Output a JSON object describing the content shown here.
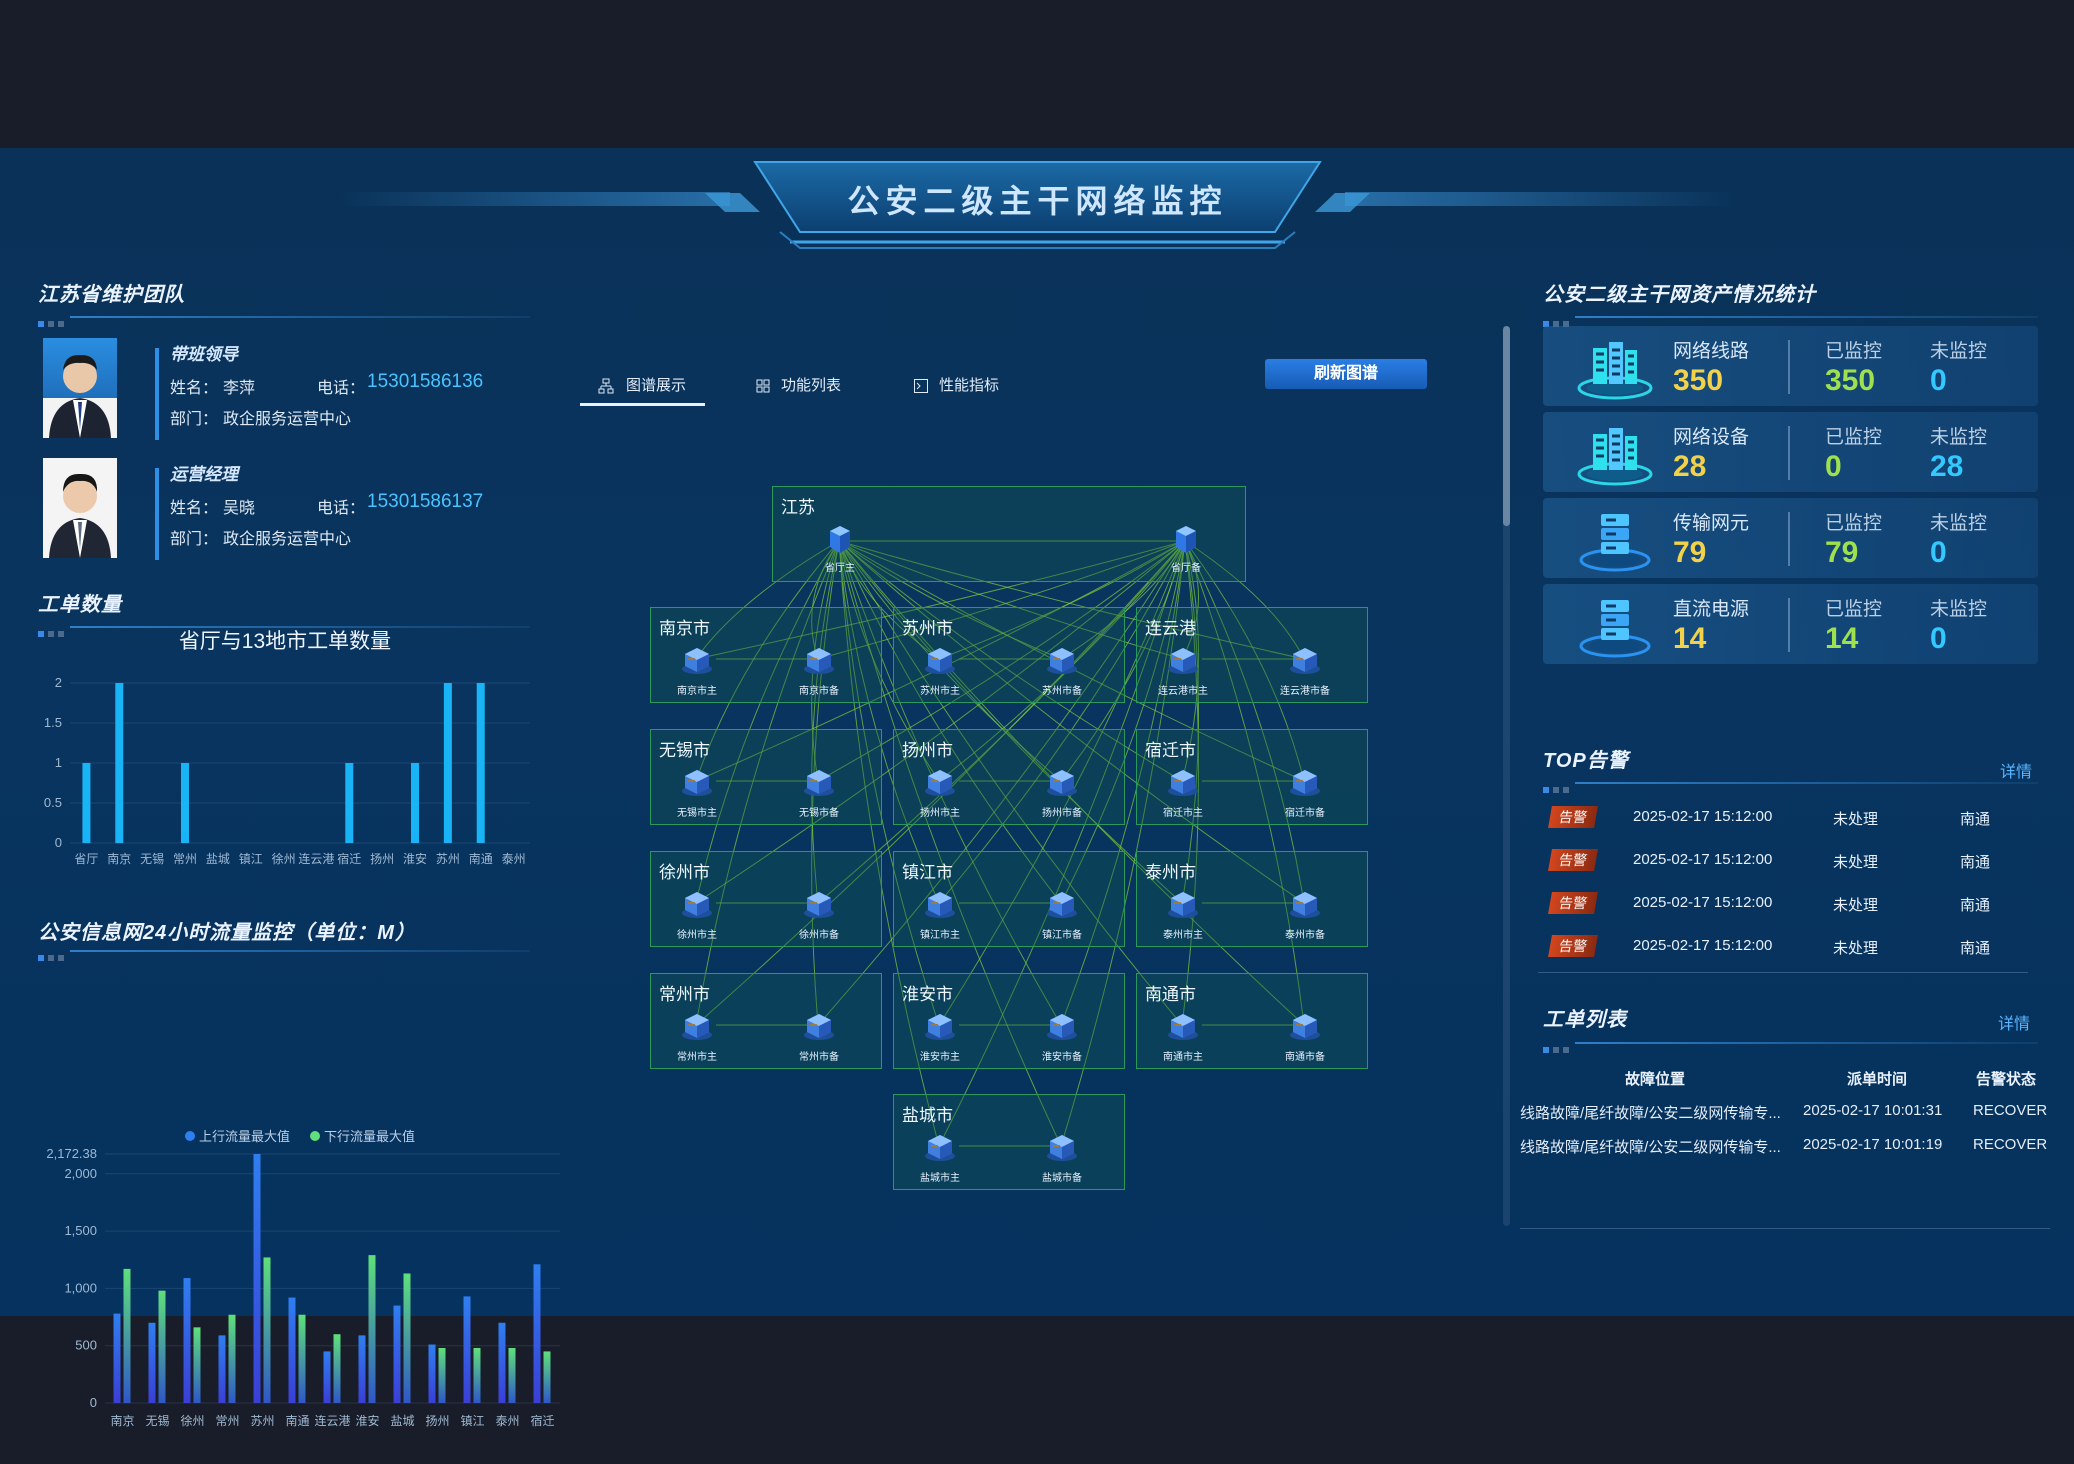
{
  "page_title": "公安二级主干网络监控",
  "team": {
    "title": "江苏省维护团队",
    "members": [
      {
        "role": "带班领导",
        "name_label": "姓名：",
        "name": "李萍",
        "phone_label": "电话：",
        "phone": "15301586136",
        "dept_label": "部门：",
        "dept": "政企服务运营中心"
      },
      {
        "role": "运营经理",
        "name_label": "姓名：",
        "name": "吴晓",
        "phone_label": "电话：",
        "phone": "15301586137",
        "dept_label": "部门：",
        "dept": "政企服务运营中心"
      }
    ]
  },
  "workorder_chart_section": {
    "title": "工单数量"
  },
  "traffic_section": {
    "title": "公安信息网24小时流量监控（单位：M）"
  },
  "chart_data": [
    {
      "type": "bar",
      "title": "省厅与13地市工单数量",
      "categories": [
        "省厅",
        "南京",
        "无锡",
        "常州",
        "盐城",
        "镇江",
        "徐州",
        "连云港",
        "宿迁",
        "扬州",
        "淮安",
        "苏州",
        "南通",
        "泰州"
      ],
      "values": [
        1,
        2,
        0,
        1,
        0,
        0,
        0,
        0,
        1,
        0,
        1,
        2,
        2,
        0
      ],
      "ylim": [
        0,
        2
      ],
      "yticks": [
        "0",
        "0.5",
        "1",
        "1.5",
        "2"
      ],
      "grid": true,
      "color": "#18b4f5"
    },
    {
      "type": "bar",
      "title": "",
      "categories": [
        "南京",
        "无锡",
        "徐州",
        "常州",
        "苏州",
        "南通",
        "连云港",
        "淮安",
        "盐城",
        "扬州",
        "镇江",
        "泰州",
        "宿迁"
      ],
      "series": [
        {
          "name": "上行流量最大值",
          "color": "#2f7ff0",
          "values": [
            780,
            700,
            1090,
            590,
            2172.38,
            920,
            450,
            590,
            850,
            510,
            930,
            700,
            1210
          ]
        },
        {
          "name": "下行流量最大值",
          "color": "#5fe07a",
          "values": [
            1170,
            980,
            660,
            770,
            1270,
            770,
            600,
            1290,
            1130,
            480,
            480,
            480,
            450
          ]
        }
      ],
      "ylim": [
        0,
        2172.38
      ],
      "yticks": [
        "0",
        "500",
        "1,000",
        "1,500",
        "2,000",
        "2,172.38"
      ],
      "legend_position": "top-center",
      "grid": true
    }
  ],
  "tabs": [
    {
      "label": "图谱展示",
      "icon": "topology-icon",
      "active": true
    },
    {
      "label": "功能列表",
      "icon": "grid-icon",
      "active": false
    },
    {
      "label": "性能指标",
      "icon": "terminal-icon",
      "active": false
    }
  ],
  "refresh_button": "刷新图谱",
  "topology": {
    "root": {
      "label": "江苏",
      "devices": [
        "省厅主",
        "省厅备"
      ]
    },
    "cities": [
      {
        "label": "南京市",
        "devices": [
          "南京市主",
          "南京市备"
        ]
      },
      {
        "label": "苏州市",
        "devices": [
          "苏州市主",
          "苏州市备"
        ]
      },
      {
        "label": "连云港",
        "devices": [
          "连云港市主",
          "连云港市备"
        ]
      },
      {
        "label": "无锡市",
        "devices": [
          "无锡市主",
          "无锡市备"
        ]
      },
      {
        "label": "扬州市",
        "devices": [
          "扬州市主",
          "扬州市备"
        ]
      },
      {
        "label": "宿迁市",
        "devices": [
          "宿迁市主",
          "宿迁市备"
        ]
      },
      {
        "label": "徐州市",
        "devices": [
          "徐州市主",
          "徐州市备"
        ]
      },
      {
        "label": "镇江市",
        "devices": [
          "镇江市主",
          "镇江市备"
        ]
      },
      {
        "label": "泰州市",
        "devices": [
          "泰州市主",
          "泰州市备"
        ]
      },
      {
        "label": "常州市",
        "devices": [
          "常州市主",
          "常州市备"
        ]
      },
      {
        "label": "淮安市",
        "devices": [
          "淮安市主",
          "淮安市备"
        ]
      },
      {
        "label": "南通市",
        "devices": [
          "南通市主",
          "南通市备"
        ]
      },
      {
        "label": "盐城市",
        "devices": [
          "盐城市主",
          "盐城市备"
        ]
      }
    ],
    "link_color": "#7fcf3a"
  },
  "assets": {
    "title": "公安二级主干网资产情况统计",
    "monitored_label": "已监控",
    "unmonitored_label": "未监控",
    "items": [
      {
        "name": "网络线路",
        "total": "350",
        "monitored": "350",
        "unmonitored": "0",
        "icon": "building-icon"
      },
      {
        "name": "网络设备",
        "total": "28",
        "monitored": "0",
        "unmonitored": "28",
        "icon": "building-icon"
      },
      {
        "name": "传输网元",
        "total": "79",
        "monitored": "79",
        "unmonitored": "0",
        "icon": "server-icon"
      },
      {
        "name": "直流电源",
        "total": "14",
        "monitored": "14",
        "unmonitored": "0",
        "icon": "server-icon"
      }
    ],
    "colors": {
      "total": "#f2d24a",
      "monitored": "#9fe04f",
      "unmonitored": "#33c9ff"
    }
  },
  "top_alarms": {
    "title": "TOP告警",
    "detail_link": "详情",
    "rows": [
      {
        "badge": "告警",
        "time": "2025-02-17 15:12:00",
        "status": "未处理",
        "location": "南通"
      },
      {
        "badge": "告警",
        "time": "2025-02-17 15:12:00",
        "status": "未处理",
        "location": "南通"
      },
      {
        "badge": "告警",
        "time": "2025-02-17 15:12:00",
        "status": "未处理",
        "location": "南通"
      },
      {
        "badge": "告警",
        "time": "2025-02-17 15:12:00",
        "status": "未处理",
        "location": "南通"
      }
    ]
  },
  "work_orders": {
    "title": "工单列表",
    "detail_link": "详情",
    "columns": [
      "故障位置",
      "派单时间",
      "告警状态"
    ],
    "rows": [
      {
        "location": "线路故障/尾纤故障/公安二级网传输专...",
        "time": "2025-02-17 10:01:31",
        "state": "RECOVER"
      },
      {
        "location": "线路故障/尾纤故障/公安二级网传输专...",
        "time": "2025-02-17 10:01:19",
        "state": "RECOVER"
      }
    ]
  }
}
